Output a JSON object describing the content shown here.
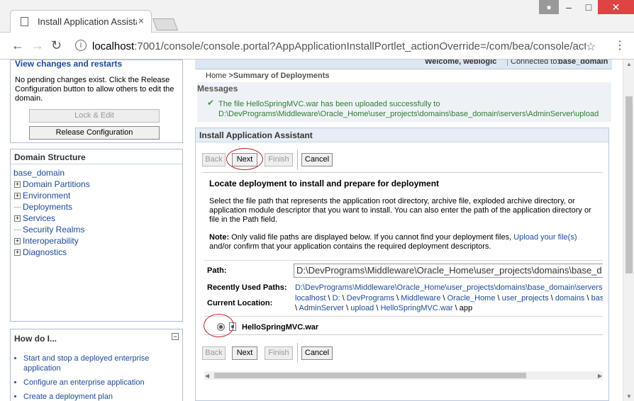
{
  "browser": {
    "tab_title": "Install Application Assista",
    "tab_close": "×",
    "url_host": "localhost",
    "url_rest": ":7001/console/console.portal?AppApplicationInstallPortlet_actionOverride=/com/bea/console/actions/a",
    "info_icon": "i"
  },
  "header": {
    "welcome": "Welcome, weblogic",
    "connected_label": "Connected to:",
    "domain": "base_domain"
  },
  "change_center": {
    "title": "View changes and restarts",
    "message": "No pending changes exist. Click the Release Configuration button to allow others to edit the domain.",
    "lock_button": "Lock & Edit",
    "release_button": "Release Configuration"
  },
  "domain_structure": {
    "title": "Domain Structure",
    "root": "base_domain",
    "items": [
      {
        "label": "Domain Partitions",
        "expandable": true
      },
      {
        "label": "Environment",
        "expandable": true
      },
      {
        "label": "Deployments",
        "expandable": false
      },
      {
        "label": "Services",
        "expandable": true
      },
      {
        "label": "Security Realms",
        "expandable": false
      },
      {
        "label": "Interoperability",
        "expandable": true
      },
      {
        "label": "Diagnostics",
        "expandable": true
      }
    ]
  },
  "how_do_i": {
    "title": "How do I...",
    "collapse": "−",
    "items": [
      "Start and stop a deployed enterprise application",
      "Configure an enterprise application",
      "Create a deployment plan"
    ]
  },
  "breadcrumb": {
    "home": "Home",
    "sep": ">",
    "current": "Summary of Deployments"
  },
  "messages": {
    "title": "Messages",
    "text": "The file HelloSpringMVC.war has been uploaded successfully to D:\\DevPrograms\\Middleware\\Oracle_Home\\user_projects\\domains\\base_domain\\servers\\AdminServer\\upload"
  },
  "assistant": {
    "title": "Install Application Assistant",
    "back": "Back",
    "next": "Next",
    "finish": "Finish",
    "cancel": "Cancel",
    "heading": "Locate deployment to install and prepare for deployment",
    "description": "Select the file path that represents the application root directory, archive file, exploded archive directory, or application module descriptor that you want to install. You can also enter the path of the application directory or file in the Path field.",
    "note_label": "Note:",
    "note_text": " Only valid file paths are displayed below. If you cannot find your deployment files, ",
    "note_link": "Upload your file(s)",
    "note_text2": "and/or confirm that your application contains the required deployment descriptors.",
    "path_label": "Path:",
    "path_value": "D:\\DevPrograms\\Middleware\\Oracle_Home\\user_projects\\domains\\base_d",
    "recent_label": "Recently Used Paths:",
    "recent_value": "D:\\DevPrograms\\Middleware\\Oracle_Home\\user_projects\\domains\\base_domain\\servers",
    "location_label": "Current Location:",
    "location_line1": [
      "localhost",
      "D:",
      "DevPrograms",
      "Middleware",
      "Oracle_Home",
      "user_projects",
      "domains",
      "bas"
    ],
    "location_line2": [
      "AdminServer",
      "upload",
      "HelloSpringMVC.war"
    ],
    "location_last": "app",
    "file_name": "HelloSpringMVC.war"
  }
}
